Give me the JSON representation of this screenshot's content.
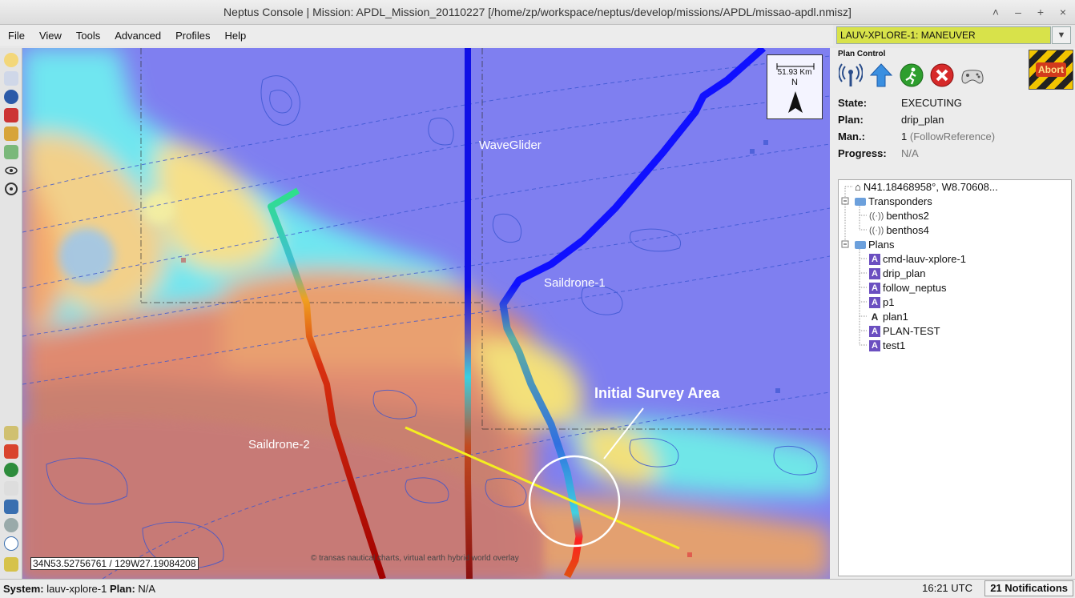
{
  "window": {
    "title": "Neptus Console | Mission: APDL_Mission_20110227 [/home/zp/workspace/neptus/develop/missions/APDL/missao-apdl.nmisz]"
  },
  "menu": [
    "File",
    "View",
    "Tools",
    "Advanced",
    "Profiles",
    "Help"
  ],
  "vehicle_selector": {
    "value": "LAUV-XPLORE-1: MANEUVER",
    "color": "#d8e24a"
  },
  "plan_control": {
    "title": "Plan Control",
    "icons": [
      "antenna-icon",
      "upload-arrow-icon",
      "start-plan-icon",
      "stop-plan-icon",
      "gamepad-icon"
    ],
    "abort_label": "Abort",
    "state_label": "State:",
    "state_value": "EXECUTING",
    "plan_label": "Plan:",
    "plan_value": "drip_plan",
    "man_label": "Man.:",
    "man_value": "1",
    "man_detail": "(FollowReference)",
    "progress_label": "Progress:",
    "progress_value": "N/A"
  },
  "tree": {
    "root": "N41.18468958°, W8.70608...",
    "transponders": {
      "label": "Transponders",
      "items": [
        "benthos2",
        "benthos4"
      ]
    },
    "plans": {
      "label": "Plans",
      "items": [
        "cmd-lauv-xplore-1",
        "drip_plan",
        "follow_neptus",
        "p1",
        "plan1",
        "PLAN-TEST",
        "test1"
      ]
    }
  },
  "map": {
    "labels": {
      "waveglider": "WaveGlider",
      "saildrone1": "Saildrone-1",
      "saildrone2": "Saildrone-2",
      "survey": "Initial Survey Area"
    },
    "scale": "51.93 Km",
    "north": "N",
    "coordinates": "34N53.52756761 / 129W27.19084208",
    "credit": "© transas nautical charts, virtual earth hybrid world overlay"
  },
  "status": {
    "system_label": "System:",
    "system_value": "lauv-xplore-1",
    "plan_label": "Plan:",
    "plan_value": "N/A",
    "time": "16:21 UTC",
    "notifications": "21 Notifications"
  }
}
